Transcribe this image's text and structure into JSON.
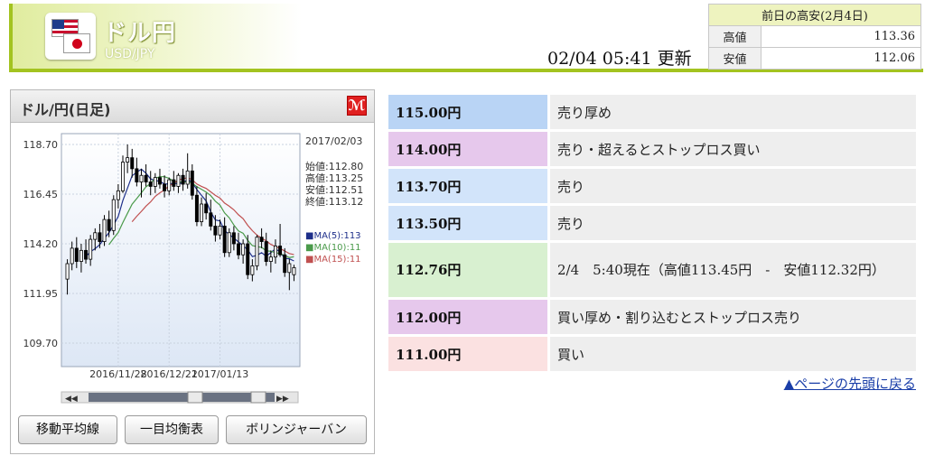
{
  "header": {
    "pair_title": "ドル円",
    "pair_code": "USD/JPY",
    "update_time": "02/04 05:41 更新",
    "prev_day": {
      "caption": "前日の高安(2月4日)",
      "high_label": "高値",
      "high_value": "113.36",
      "low_label": "安値",
      "low_value": "112.06"
    }
  },
  "chart_panel": {
    "title": "ドル/円(日足)",
    "info": {
      "date": "2017/02/03",
      "open": "始値:112.80",
      "high": "高値:113.25",
      "low": "安値:112.51",
      "close": "終値:113.12"
    },
    "legend": {
      "ma5": "■MA(5):113",
      "ma10": "■MA(10):11",
      "ma15": "■MA(15):11"
    },
    "buttons": {
      "ma": "移動平均線",
      "ichimoku": "一目均衡表",
      "bollinger": "ボリンジャーバン"
    },
    "scroll": {
      "left": "◀◀",
      "right": "▶▶"
    }
  },
  "chart_data": {
    "type": "candlestick",
    "title": "ドル/円(日足)",
    "ylim": [
      109.7,
      118.7
    ],
    "y_ticks": [
      "118.70",
      "116.45",
      "114.20",
      "111.95",
      "109.70"
    ],
    "x_ticks": [
      "2016/11/28",
      "2016/12/21",
      "2017/01/13"
    ],
    "grid": true,
    "candles": [
      [
        112.6,
        113.5,
        111.9,
        113.3
      ],
      [
        113.3,
        114.3,
        113.0,
        114.0
      ],
      [
        114.0,
        114.5,
        113.1,
        113.4
      ],
      [
        113.4,
        114.2,
        112.9,
        113.9
      ],
      [
        113.9,
        114.4,
        113.3,
        113.5
      ],
      [
        113.5,
        114.6,
        113.2,
        114.4
      ],
      [
        114.4,
        114.9,
        113.9,
        114.7
      ],
      [
        114.7,
        115.1,
        114.0,
        114.3
      ],
      [
        114.3,
        115.5,
        114.1,
        115.3
      ],
      [
        115.3,
        115.7,
        114.5,
        114.8
      ],
      [
        114.8,
        116.4,
        114.6,
        116.2
      ],
      [
        116.2,
        116.9,
        115.8,
        116.6
      ],
      [
        116.6,
        118.2,
        116.5,
        117.9
      ],
      [
        117.9,
        118.7,
        117.4,
        118.1
      ],
      [
        118.1,
        118.5,
        117.2,
        117.6
      ],
      [
        117.6,
        118.1,
        116.8,
        117.0
      ],
      [
        117.0,
        117.6,
        116.3,
        117.3
      ],
      [
        117.3,
        117.8,
        116.8,
        117.0
      ],
      [
        117.0,
        117.5,
        116.4,
        116.8
      ],
      [
        116.8,
        117.4,
        116.5,
        117.2
      ],
      [
        117.2,
        117.6,
        116.7,
        116.9
      ],
      [
        116.9,
        117.3,
        116.3,
        116.6
      ],
      [
        116.6,
        117.2,
        116.4,
        117.1
      ],
      [
        117.1,
        117.5,
        116.6,
        116.8
      ],
      [
        116.8,
        117.4,
        116.5,
        117.3
      ],
      [
        117.3,
        117.6,
        116.6,
        116.9
      ],
      [
        116.9,
        118.3,
        116.7,
        117.5
      ],
      [
        117.5,
        117.8,
        116.2,
        116.4
      ],
      [
        116.4,
        116.8,
        115.0,
        115.2
      ],
      [
        115.2,
        116.3,
        115.0,
        116.0
      ],
      [
        116.0,
        116.5,
        115.3,
        115.6
      ],
      [
        115.6,
        116.2,
        114.8,
        115.0
      ],
      [
        115.0,
        115.5,
        114.3,
        114.6
      ],
      [
        114.6,
        115.3,
        114.4,
        115.0
      ],
      [
        115.0,
        115.4,
        113.6,
        113.8
      ],
      [
        113.8,
        114.9,
        113.6,
        114.7
      ],
      [
        114.7,
        115.0,
        113.9,
        114.2
      ],
      [
        114.2,
        114.7,
        113.5,
        113.7
      ],
      [
        113.7,
        114.4,
        113.3,
        114.2
      ],
      [
        114.2,
        114.6,
        112.6,
        112.8
      ],
      [
        112.8,
        113.5,
        112.5,
        113.2
      ],
      [
        113.2,
        114.6,
        113.0,
        114.5
      ],
      [
        114.5,
        114.9,
        114.0,
        114.3
      ],
      [
        114.3,
        114.7,
        113.2,
        113.4
      ],
      [
        113.4,
        113.9,
        112.9,
        113.6
      ],
      [
        113.6,
        114.4,
        113.3,
        114.1
      ],
      [
        114.1,
        115.1,
        113.6,
        113.7
      ],
      [
        113.7,
        114.0,
        112.7,
        112.9
      ],
      [
        112.9,
        113.5,
        112.1,
        113.3
      ],
      [
        112.8,
        113.25,
        112.51,
        113.12
      ]
    ],
    "series": [
      {
        "name": "MA(5)",
        "color": "#1e2f8a"
      },
      {
        "name": "MA(10)",
        "color": "#4a9a4a"
      },
      {
        "name": "MA(15)",
        "color": "#c05050"
      }
    ]
  },
  "levels": [
    {
      "price": "115.00円",
      "note": "売り厚め",
      "color": "#b9d4f5"
    },
    {
      "price": "114.00円",
      "note": "売り・超えるとストップロス買い",
      "color": "#e6c8ec"
    },
    {
      "price": "113.70円",
      "note": "売り",
      "color": "#d2e4fa"
    },
    {
      "price": "113.50円",
      "note": "売り",
      "color": "#d2e4fa"
    },
    {
      "price": "112.76円",
      "note": "2/4　5:40現在（高値113.45円　-　安値112.32円）",
      "color": "#d8f0d0"
    },
    {
      "price": "112.00円",
      "note": "買い厚め・割り込むとストップロス売り",
      "color": "#e6c8ec"
    },
    {
      "price": "111.00円",
      "note": "買い",
      "color": "#fbe1e1"
    }
  ],
  "back_link": "▲ページの先頭に戻る"
}
